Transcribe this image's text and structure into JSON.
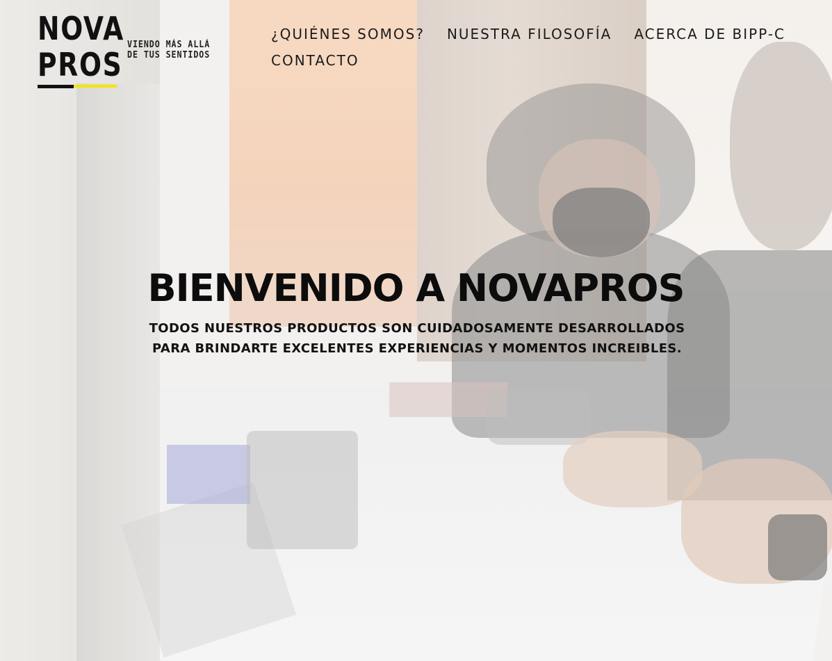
{
  "brand": {
    "logo_word_top": "NOVA",
    "logo_word_bottom": "PROS",
    "tagline_line1": "VIENDO MÁS ALLÁ",
    "tagline_line2": "DE TUS SENTIDOS",
    "accent_color": "#f3e600"
  },
  "nav": {
    "items": [
      {
        "label": "¿QUIÉNES SOMOS?"
      },
      {
        "label": "NUESTRA FILOSOFÍA"
      },
      {
        "label": "ACERCA DE BIPP-C"
      },
      {
        "label": "CONTACTO"
      }
    ]
  },
  "hero": {
    "title": "BIENVENIDO A NOVAPROS",
    "subtitle_line1": "TODOS NUESTROS PRODUCTOS SON CUIDADOSAMENTE DESARROLLADOS",
    "subtitle_line2": "PARA BRINDARTE EXCELENTES EXPERIENCIAS Y MOMENTOS INCREIBLES."
  }
}
